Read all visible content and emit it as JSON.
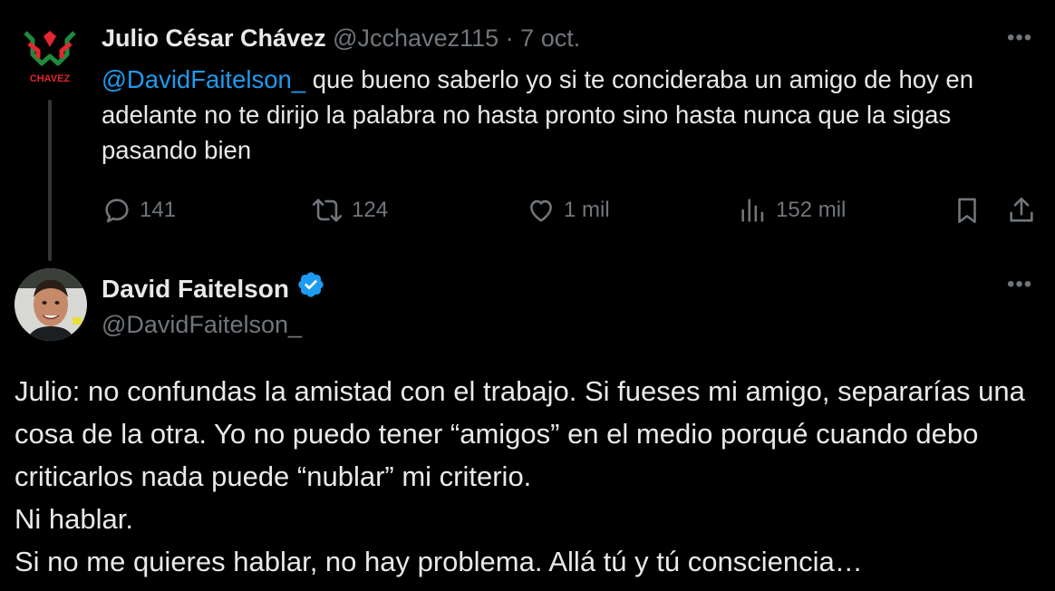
{
  "tweet1": {
    "display_name": "Julio César Chávez",
    "handle": "@Jcchavez115",
    "separator": "·",
    "date": "7 oct.",
    "logo_text": "CHAVEZ",
    "more_label": "•••",
    "mention": "@DavidFaitelson_",
    "text": " que bueno saberlo yo si te concideraba un amigo de hoy en adelante no te dirijo la palabra no hasta pronto sino hasta nunca que la sigas pasando bien",
    "stats": {
      "replies": "141",
      "reposts": "124",
      "likes": "1 mil",
      "views": "152 mil"
    }
  },
  "tweet2": {
    "display_name": "David Faitelson",
    "handle": "@DavidFaitelson_",
    "more_label": "•••",
    "text": "Julio: no confundas la amistad con el trabajo. Si fueses mi amigo, separarías una cosa de la otra. Yo no puedo tener “amigos” en el medio porqué cuando debo criticarlos nada puede “nublar” mi criterio.\nNi hablar.\nSi no me quieres hablar, no hay problema. Allá tú y tú consciencia…"
  },
  "colors": {
    "background": "#000000",
    "text": "#e7e9ea",
    "muted": "#71767b",
    "mention": "#1d9bf0",
    "verified": "#1d9bf0",
    "logo_red": "#e3262f",
    "logo_green": "#1f8a3c"
  },
  "icons": {
    "reply": "reply-icon",
    "repost": "repost-icon",
    "like": "heart-icon",
    "views": "views-icon",
    "bookmark": "bookmark-icon",
    "share": "share-icon",
    "verified": "verified-badge-icon"
  }
}
